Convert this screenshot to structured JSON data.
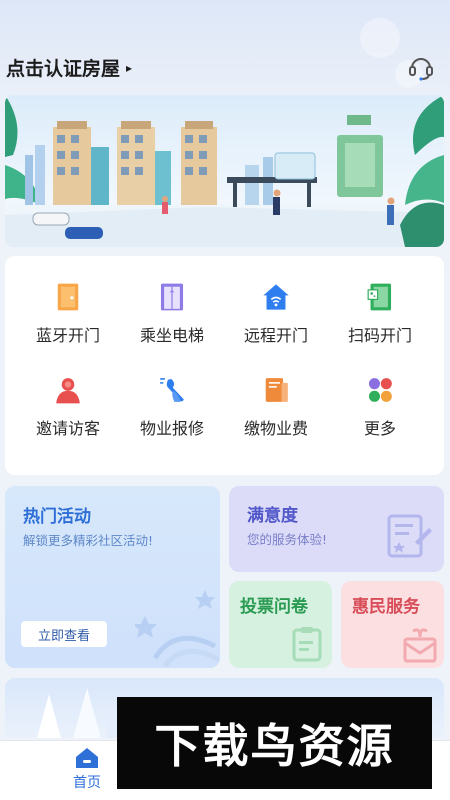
{
  "header": {
    "house_label": "点击认证房屋",
    "arrow": "▸",
    "service_icon": "headset-icon"
  },
  "banner": {
    "image": "community-illustration"
  },
  "grid": [
    {
      "label": "蓝牙开门",
      "icon": "bluetooth-door-icon",
      "color": "#f39b3a"
    },
    {
      "label": "乘坐电梯",
      "icon": "elevator-icon",
      "color": "#8f7be6"
    },
    {
      "label": "远程开门",
      "icon": "remote-door-icon",
      "color": "#2f7ef0"
    },
    {
      "label": "扫码开门",
      "icon": "qr-door-icon",
      "color": "#2fae5b"
    },
    {
      "label": "邀请访客",
      "icon": "invite-visitor-icon",
      "color": "#e8504f"
    },
    {
      "label": "物业报修",
      "icon": "repair-icon",
      "color": "#2f7ef0"
    },
    {
      "label": "缴物业费",
      "icon": "pay-fee-icon",
      "color": "#ef8a3a"
    },
    {
      "label": "更多",
      "icon": "more-icon",
      "color": "#8b6fe0"
    }
  ],
  "activities": {
    "hot": {
      "title": "热门活动",
      "subtitle": "解锁更多精彩社区活动!",
      "button": "立即查看"
    },
    "satisfaction": {
      "title": "满意度",
      "subtitle": "您的服务体验!"
    },
    "vote": {
      "title": "投票问卷"
    },
    "benefit": {
      "title": "惠民服务"
    }
  },
  "tabbar": {
    "home": "首页"
  },
  "watermark": "下载鸟资源"
}
